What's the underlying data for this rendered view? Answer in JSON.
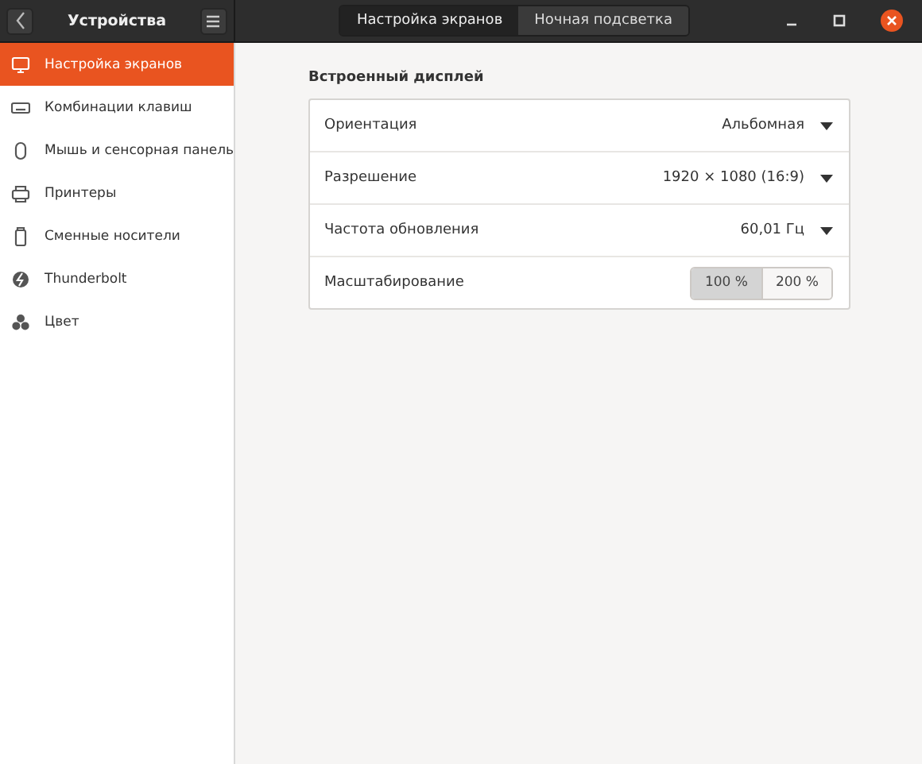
{
  "header": {
    "title": "Устройства",
    "tabs": [
      {
        "label": "Настройка экранов",
        "selected": true
      },
      {
        "label": "Ночная подсветка",
        "selected": false
      }
    ]
  },
  "sidebar": {
    "items": [
      {
        "label": "Настройка экранов",
        "selected": true
      },
      {
        "label": "Комбинации клавиш",
        "selected": false
      },
      {
        "label": "Мышь и сенсорная панель",
        "selected": false
      },
      {
        "label": "Принтеры",
        "selected": false
      },
      {
        "label": "Сменные носители",
        "selected": false
      },
      {
        "label": "Thunderbolt",
        "selected": false
      },
      {
        "label": "Цвет",
        "selected": false
      }
    ]
  },
  "section": {
    "title": "Встроенный дисплей",
    "rows": [
      {
        "kind": "dropdown",
        "label": "Ориентация",
        "value": "Альбомная"
      },
      {
        "kind": "dropdown",
        "label": "Разрешение",
        "value": "1920 × 1080 (16:9)"
      },
      {
        "kind": "dropdown",
        "label": "Частота обновления",
        "value": "60,01 Гц"
      },
      {
        "kind": "toggle",
        "label": "Масштабирование",
        "options": [
          {
            "label": "100 %",
            "selected": true
          },
          {
            "label": "200 %",
            "selected": false
          }
        ]
      }
    ]
  }
}
